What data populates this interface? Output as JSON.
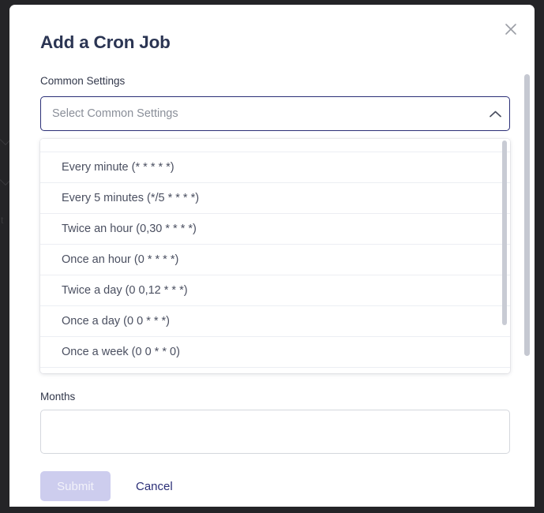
{
  "dialog": {
    "title": "Add a Cron Job",
    "close_icon": "close-icon"
  },
  "fields": {
    "common_settings": {
      "label": "Common Settings",
      "placeholder": "Select Common Settings",
      "value": "",
      "expanded": true,
      "caret_icon": "chevron-up-icon"
    },
    "months": {
      "label": "Months",
      "value": "",
      "placeholder": ""
    }
  },
  "dropdown": {
    "options": [
      {
        "label": "Every minute (* * * * *)"
      },
      {
        "label": "Every 5 minutes (*/5 * * * *)"
      },
      {
        "label": "Twice an hour (0,30 * * * *)"
      },
      {
        "label": "Once an hour (0 * * * *)"
      },
      {
        "label": "Twice a day (0 0,12 * * *)"
      },
      {
        "label": "Once a day (0 0 * * *)"
      },
      {
        "label": "Once a week (0 0 * * 0)"
      }
    ]
  },
  "actions": {
    "submit_label": "Submit",
    "cancel_label": "Cancel"
  },
  "backdrop": {
    "hint_text": "t"
  },
  "colors": {
    "title": "#2b3553",
    "accent": "#2b2f77",
    "submit_disabled_bg": "#cdcdee",
    "backdrop": "#242427",
    "border_focus": "#2b2f77",
    "border_idle": "#d4d7dd"
  }
}
